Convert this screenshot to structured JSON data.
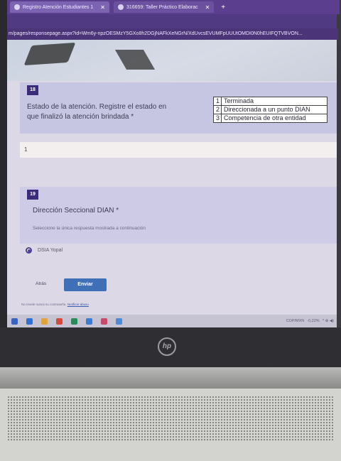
{
  "browser": {
    "tabs": [
      {
        "label": "Registro Atención Estudiantes 1",
        "close": "✕",
        "active": true
      },
      {
        "label": "316659: Taller Práctico Elaborac",
        "close": "✕",
        "active": false
      }
    ],
    "new_tab": "+",
    "url": "m/pages/responsepage.aspx?id=Wm6y-npzOESMzY5GXo8h2DGjNAFkXeNGrN/XdUvcsEVUMFpUUUtOMDI0N0hEUIFQTVBVON..."
  },
  "form": {
    "q18": {
      "number": "18",
      "text": "Estado de la atención. Registre el estado en que finalizó la atención brindada *",
      "reference_table": [
        {
          "n": "1",
          "label": "Terminada"
        },
        {
          "n": "2",
          "label": "Direccionada a un punto DIAN"
        },
        {
          "n": "3",
          "label": "Competencia de otra entidad"
        }
      ],
      "answer_value": "1"
    },
    "q19": {
      "number": "19",
      "text": "Dirección Seccional DIAN *",
      "subtext": "Seleccione la única respuesta mostrada a continuación",
      "option_label": "DSIA Yopal",
      "option_selected": true
    },
    "back_label": "Atrás",
    "submit_label": "Enviar",
    "password_note": "No revele nunca su contraseña.",
    "report_link": "Notificar abuso"
  },
  "taskbar": {
    "ticker": "COP/MXN",
    "ticker_change": "-0,22%",
    "tray": "^ ⊕ ◀)"
  },
  "laptop": {
    "logo_text": "hp"
  },
  "colors": {
    "tab_bar": "#5b3f8e",
    "form_accent": "#3b2b7a",
    "submit_button": "#3f6fb6",
    "question_card": "#c6c6e3"
  }
}
